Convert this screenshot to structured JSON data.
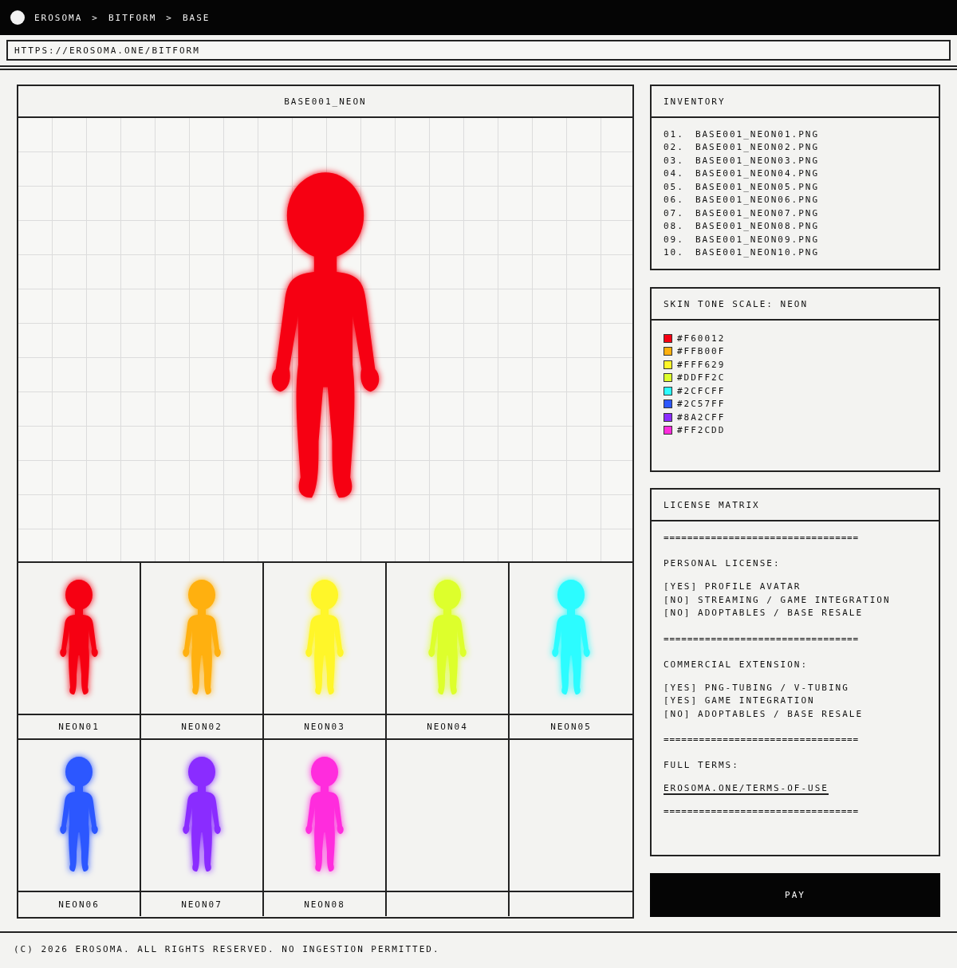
{
  "breadcrumb": [
    "EROSOMA",
    ">",
    "BITFORM",
    ">",
    "BASE"
  ],
  "address_bar": {
    "value": "HTTPS://EROSOMA.ONE/BITFORM"
  },
  "preview": {
    "title": "BASE001_NEON",
    "color": "#f60012"
  },
  "tiles": [
    {
      "label": "NEON01",
      "color": "#f60012"
    },
    {
      "label": "NEON02",
      "color": "#ffb00f"
    },
    {
      "label": "NEON03",
      "color": "#fff629"
    },
    {
      "label": "NEON04",
      "color": "#ddff2c"
    },
    {
      "label": "NEON05",
      "color": "#2cfcff"
    },
    {
      "label": "NEON06",
      "color": "#2c57ff"
    },
    {
      "label": "NEON07",
      "color": "#8a2cff"
    },
    {
      "label": "NEON08",
      "color": "#ff2cdd"
    }
  ],
  "inventory": {
    "title": "INVENTORY",
    "items": [
      {
        "number": "01.",
        "file": "BASE001_NEON01.PNG"
      },
      {
        "number": "02.",
        "file": "BASE001_NEON02.PNG"
      },
      {
        "number": "03.",
        "file": "BASE001_NEON03.PNG"
      },
      {
        "number": "04.",
        "file": "BASE001_NEON04.PNG"
      },
      {
        "number": "05.",
        "file": "BASE001_NEON05.PNG"
      },
      {
        "number": "06.",
        "file": "BASE001_NEON06.PNG"
      },
      {
        "number": "07.",
        "file": "BASE001_NEON07.PNG"
      },
      {
        "number": "08.",
        "file": "BASE001_NEON08.PNG"
      },
      {
        "number": "09.",
        "file": "BASE001_NEON09.PNG"
      },
      {
        "number": "10.",
        "file": "BASE001_NEON10.PNG"
      }
    ]
  },
  "skin_tones": {
    "title": "SKIN TONE SCALE: NEON",
    "swatches": [
      {
        "label": "#F60012",
        "color": "#f60012"
      },
      {
        "label": "#FFB00F",
        "color": "#ffb00f"
      },
      {
        "label": "#FFF629",
        "color": "#fff629"
      },
      {
        "label": "#DDFF2C",
        "color": "#ddff2c"
      },
      {
        "label": "#2CFCFF",
        "color": "#2cfcff"
      },
      {
        "label": "#2C57FF",
        "color": "#2c57ff"
      },
      {
        "label": "#8A2CFF",
        "color": "#8a2cff"
      },
      {
        "label": "#FF2CDD",
        "color": "#ff2cdd"
      }
    ]
  },
  "license": {
    "title": "LICENSE MATRIX",
    "lines": [
      {
        "kind": "rule",
        "text": "================================="
      },
      {
        "kind": "heading",
        "text": "PERSONAL LICENSE:"
      },
      {
        "kind": "item",
        "text": "[YES] PROFILE AVATAR"
      },
      {
        "kind": "item",
        "text": "[NO] STREAMING / GAME INTEGRATION"
      },
      {
        "kind": "item",
        "text": "[NO] ADOPTABLES / BASE RESALE"
      },
      {
        "kind": "rule",
        "text": "================================="
      },
      {
        "kind": "heading",
        "text": "COMMERCIAL EXTENSION:"
      },
      {
        "kind": "item",
        "text": "[YES] PNG-TUBING / V-TUBING"
      },
      {
        "kind": "item",
        "text": "[YES] GAME INTEGRATION"
      },
      {
        "kind": "item",
        "text": "[NO] ADOPTABLES / BASE RESALE"
      },
      {
        "kind": "rule",
        "text": "================================="
      },
      {
        "kind": "heading",
        "text": "FULL TERMS:"
      },
      {
        "kind": "link",
        "text": "EROSOMA.ONE/TERMS-OF-USE"
      },
      {
        "kind": "rule",
        "text": "================================="
      }
    ]
  },
  "pay_button": "PAY",
  "footer": "(C) 2026 EROSOMA. ALL RIGHTS RESERVED. NO INGESTION PERMITTED."
}
